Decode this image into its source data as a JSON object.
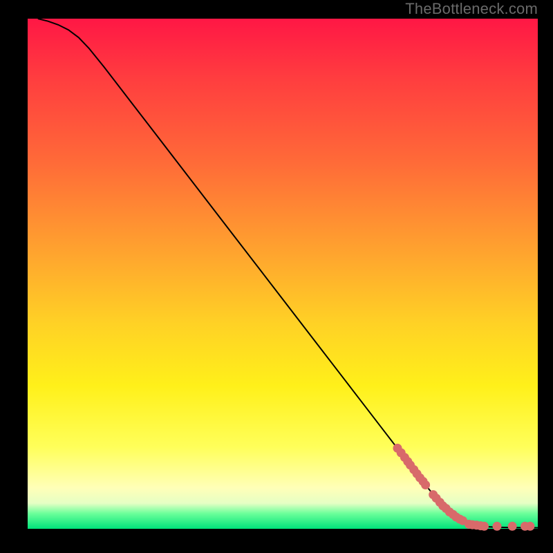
{
  "watermark": "TheBottleneck.com",
  "chart_data": {
    "type": "line",
    "title": "",
    "xlabel": "",
    "ylabel": "",
    "xlim": [
      0,
      100
    ],
    "ylim": [
      0,
      100
    ],
    "grid": false,
    "legend": false,
    "curve": {
      "name": "bottleneck-curve",
      "x": [
        2,
        4,
        6,
        8,
        10,
        12,
        15,
        20,
        25,
        30,
        35,
        40,
        45,
        50,
        55,
        60,
        65,
        70,
        75,
        78,
        80,
        82,
        85,
        88,
        90,
        92,
        95,
        98,
        100
      ],
      "y": [
        100,
        99.5,
        98.8,
        97.8,
        96.3,
        94.2,
        90.5,
        84,
        77.5,
        71,
        64.5,
        58,
        51.5,
        45,
        38.5,
        32,
        25.5,
        19,
        12.5,
        8.6,
        6.1,
        4.0,
        1.8,
        0.7,
        0.4,
        0.3,
        0.25,
        0.22,
        0.2
      ]
    },
    "series": [
      {
        "name": "cluster-upper",
        "type": "scatter",
        "x": [
          72.5,
          73.2,
          73.9,
          74.5,
          75.0,
          75.7,
          76.3,
          76.9,
          77.5,
          78.0
        ],
        "y": [
          15.8,
          14.9,
          14.0,
          13.2,
          12.5,
          11.6,
          10.8,
          10.0,
          9.3,
          8.6
        ]
      },
      {
        "name": "cluster-lower",
        "type": "scatter",
        "x": [
          79.5,
          80.1,
          80.8,
          81.4,
          82.0,
          82.7,
          83.4,
          84.0,
          84.7,
          85.3
        ],
        "y": [
          6.7,
          6.0,
          5.2,
          4.5,
          4.0,
          3.3,
          2.8,
          2.3,
          1.9,
          1.6
        ]
      },
      {
        "name": "tail-scatter",
        "type": "scatter",
        "x": [
          86.5,
          87.2,
          88.0,
          88.8,
          89.5,
          92.0,
          95.0,
          97.5,
          98.5
        ],
        "y": [
          0.9,
          0.8,
          0.7,
          0.6,
          0.5,
          0.5,
          0.5,
          0.5,
          0.5
        ]
      }
    ],
    "colors": {
      "curve": "#000000",
      "dots": "#d86a6a",
      "gradient_stops": [
        "#ff1745",
        "#ff6a38",
        "#ffd225",
        "#ffff5a",
        "#00e27a"
      ]
    }
  }
}
